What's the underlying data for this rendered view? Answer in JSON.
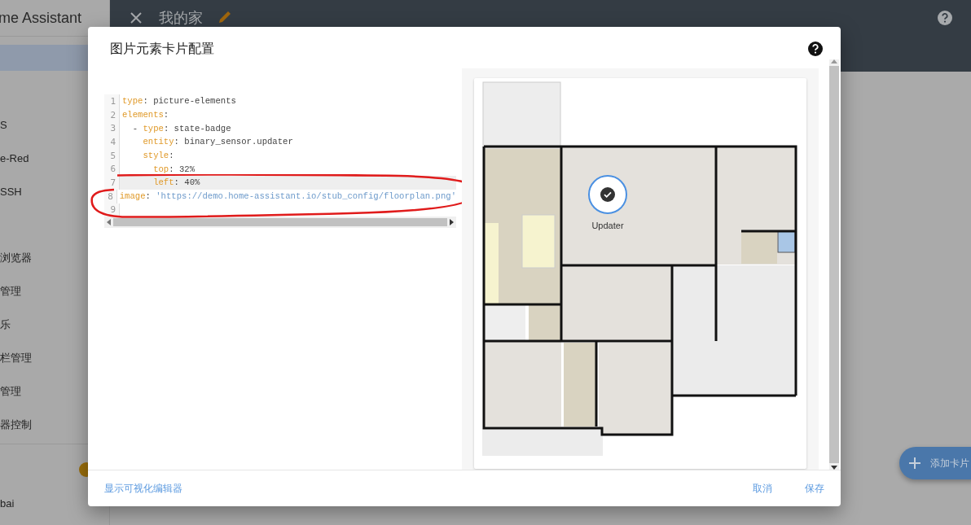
{
  "sidebar": {
    "title": "me Assistant",
    "groups": [
      [
        {
          "selected": true
        }
      ],
      [
        {
          "label": "S",
          "selected": false
        },
        {
          "label": "e-Red",
          "selected": false
        },
        {
          "label": "SSH",
          "selected": false
        }
      ],
      [
        {
          "label": "浏览器",
          "selected": false
        },
        {
          "label": "管理",
          "selected": false
        },
        {
          "label": "乐",
          "selected": false
        },
        {
          "label": "栏管理",
          "selected": false
        },
        {
          "label": "管理",
          "selected": false
        },
        {
          "label": "器控制",
          "selected": false
        }
      ]
    ],
    "bottom_items": [
      {
        "selected": false,
        "badge": true
      },
      {
        "label": "bai",
        "selected": false,
        "badge": false
      }
    ]
  },
  "header": {
    "title": "我的家"
  },
  "fab": {
    "label": "添加卡片"
  },
  "dialog": {
    "title": "图片元素卡片配置",
    "editor": {
      "lines": [
        {
          "number": "1",
          "active": false,
          "tokens": [
            {
              "kind": "key",
              "text": "type"
            },
            {
              "kind": "plain",
              "text": ": picture-elements"
            }
          ]
        },
        {
          "number": "2",
          "active": false,
          "tokens": [
            {
              "kind": "key",
              "text": "elements"
            },
            {
              "kind": "plain",
              "text": ":"
            }
          ]
        },
        {
          "number": "3",
          "active": false,
          "tokens": [
            {
              "kind": "plain",
              "text": "  - "
            },
            {
              "kind": "key",
              "text": "type"
            },
            {
              "kind": "plain",
              "text": ": state-badge"
            }
          ]
        },
        {
          "number": "4",
          "active": false,
          "tokens": [
            {
              "kind": "key",
              "text": "    entity"
            },
            {
              "kind": "plain",
              "text": ": binary_sensor.updater"
            }
          ]
        },
        {
          "number": "5",
          "active": false,
          "tokens": [
            {
              "kind": "key",
              "text": "    style"
            },
            {
              "kind": "plain",
              "text": ":"
            }
          ]
        },
        {
          "number": "6",
          "active": false,
          "tokens": [
            {
              "kind": "key",
              "text": "      top"
            },
            {
              "kind": "plain",
              "text": ": 32%"
            }
          ]
        },
        {
          "number": "7",
          "active": true,
          "tokens": [
            {
              "kind": "key",
              "text": "      left"
            },
            {
              "kind": "plain",
              "text": ": 40%"
            }
          ]
        },
        {
          "number": "8",
          "active": false,
          "tokens": [
            {
              "kind": "key",
              "text": "image"
            },
            {
              "kind": "plain",
              "text": ": "
            },
            {
              "kind": "string",
              "text": "'https://demo.home-assistant.io/stub_config/floorplan.png'"
            }
          ]
        },
        {
          "number": "9",
          "active": false
        }
      ]
    },
    "preview": {
      "badge_label": "Updater"
    },
    "footer": {
      "link": "显示可视化编辑器",
      "buttons": [
        "取消",
        "保存"
      ]
    }
  }
}
